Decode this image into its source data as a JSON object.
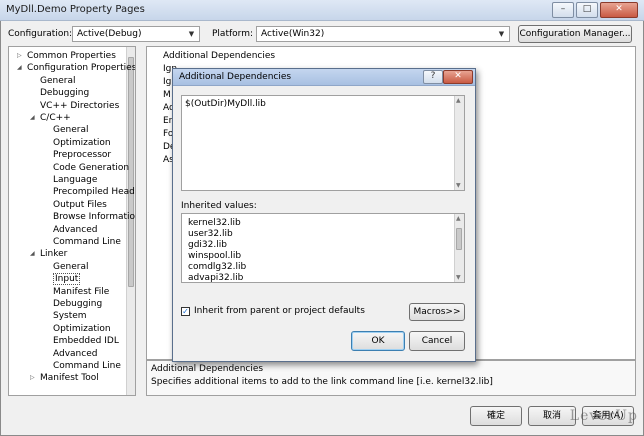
{
  "window": {
    "title": "MyDll.Demo Property Pages",
    "minimize": "–",
    "maximize": "□",
    "close": "✕"
  },
  "toolbar": {
    "configuration_label": "Configuration:",
    "configuration_value": "Active(Debug)",
    "platform_label": "Platform:",
    "platform_value": "Active(Win32)",
    "config_manager_label": "Configuration Manager..."
  },
  "tree": {
    "items": [
      {
        "label": "Common Properties",
        "twisty": "▷"
      },
      {
        "label": "Configuration Properties",
        "twisty": "◢"
      },
      {
        "label": "General"
      },
      {
        "label": "Debugging"
      },
      {
        "label": "VC++ Directories"
      },
      {
        "label": "C/C++",
        "twisty": "◢"
      },
      {
        "label": "General"
      },
      {
        "label": "Optimization"
      },
      {
        "label": "Preprocessor"
      },
      {
        "label": "Code Generation"
      },
      {
        "label": "Language"
      },
      {
        "label": "Precompiled Head"
      },
      {
        "label": "Output Files"
      },
      {
        "label": "Browse Informatio"
      },
      {
        "label": "Advanced"
      },
      {
        "label": "Command Line"
      },
      {
        "label": "Linker",
        "twisty": "◢"
      },
      {
        "label": "General"
      },
      {
        "label": "Input"
      },
      {
        "label": "Manifest File"
      },
      {
        "label": "Debugging"
      },
      {
        "label": "System"
      },
      {
        "label": "Optimization"
      },
      {
        "label": "Embedded IDL"
      },
      {
        "label": "Advanced"
      },
      {
        "label": "Command Line"
      },
      {
        "label": "Manifest Tool",
        "twisty": "▷"
      }
    ]
  },
  "grid": {
    "rows": [
      "Additional Dependencies",
      "Ign",
      "Ig",
      "M",
      "Ad",
      "En",
      "Fo",
      "De",
      "As"
    ]
  },
  "description": {
    "title": "Additional Dependencies",
    "text": "Specifies additional items to add to the link command line [i.e. kernel32.lib]"
  },
  "dialog": {
    "title": "Additional Dependencies",
    "help": "?",
    "close": "✕",
    "edit_value": "$(OutDir)MyDll.lib",
    "inherited_label": "Inherited values:",
    "inherited": [
      "kernel32.lib",
      "user32.lib",
      "gdi32.lib",
      "winspool.lib",
      "comdlg32.lib",
      "advapi32.lib"
    ],
    "inherit_checkbox_label": "Inherit from parent or project defaults",
    "checkmark": "✓",
    "macros_label": "Macros>>",
    "ok_label": "OK",
    "cancel_label": "Cancel"
  },
  "footer": {
    "ok_label": "確定",
    "cancel_label": "取消",
    "apply_label": "套用(A)"
  },
  "watermark": "LeverUp"
}
